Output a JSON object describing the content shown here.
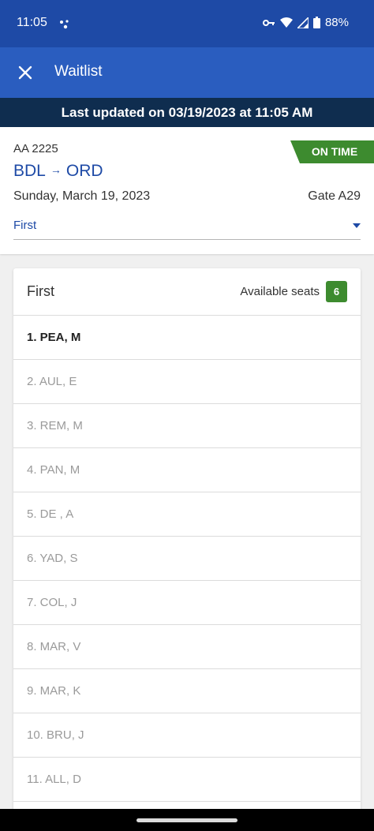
{
  "status_bar": {
    "time": "11:05",
    "battery": "88%"
  },
  "app_bar": {
    "title": "Waitlist"
  },
  "banner": {
    "text": "Last updated on 03/19/2023 at 11:05 AM"
  },
  "flight": {
    "number": "AA 2225",
    "status": "ON TIME",
    "origin": "BDL",
    "arrow": "→",
    "destination": "ORD",
    "date": "Sunday, March 19, 2023",
    "gate": "Gate A29",
    "cabin_select": "First"
  },
  "waitlist": {
    "cabin": "First",
    "available_label": "Available seats",
    "available_count": "6",
    "rows": [
      "1. PEA, M",
      "2. AUL, E",
      "3. REM, M",
      "4. PAN, M",
      "5. DE , A",
      "6. YAD, S",
      "7. COL, J",
      "8. MAR, V",
      "9. MAR, K",
      "10. BRU, J",
      "11. ALL, D"
    ]
  },
  "colors": {
    "brand_blue": "#2a5dbf",
    "banner_navy": "#0f2d4f",
    "status_green": "#3d8b2f"
  }
}
